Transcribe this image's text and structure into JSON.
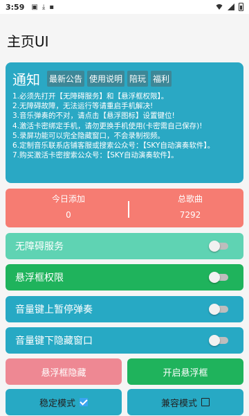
{
  "status_bar": {
    "time": "3:59"
  },
  "app_title": "主页UI",
  "notice": {
    "title": "通知",
    "tags": [
      "最新公告",
      "使用说明",
      "陪玩",
      "福利"
    ],
    "lines": [
      "1.必须先打开【无障碍服务】和【悬浮框权限】。",
      "2.无障碍故障，无法运行等请重启手机解决!",
      "3.音乐弹奏的不对，请点击【悬浮图标】设置键位!",
      "4.激活卡密绑定手机，请勿更换手机使用(卡密需自己保存)!",
      "5.录屏功能可以完全隐藏窗口，不会录制视频。",
      "6.定制音乐联系店铺客服或搜索公众号：【SKY自动演奏软件】。",
      "7.购买激活卡密搜索公众号：【SKY自动演奏软件】。"
    ]
  },
  "stats": {
    "today_label": "今日添加",
    "today_value": "0",
    "total_label": "总歌曲",
    "total_value": "7292"
  },
  "toggles": [
    {
      "label": "无障碍服务",
      "on": false,
      "color": "#5fd3b3"
    },
    {
      "label": "悬浮框权限",
      "on": false,
      "color": "#1fb35c"
    },
    {
      "label": "音量键上暂停弹奏",
      "on": false,
      "color": "#27a9c4"
    },
    {
      "label": "音量键下隐藏窗口",
      "on": false,
      "color": "#27a9c4"
    }
  ],
  "buttons": {
    "hide_float": "悬浮框隐藏",
    "open_float": "开启悬浮框",
    "stable_mode": "稳定模式",
    "compat_mode": "兼容模式"
  },
  "colors": {
    "notice_bg": "#2aa8c4",
    "stats_bg": "#f67c72",
    "hide_btn": "#ee8893",
    "open_btn": "#1fb35c",
    "mode_btn": "#27a9c4"
  }
}
